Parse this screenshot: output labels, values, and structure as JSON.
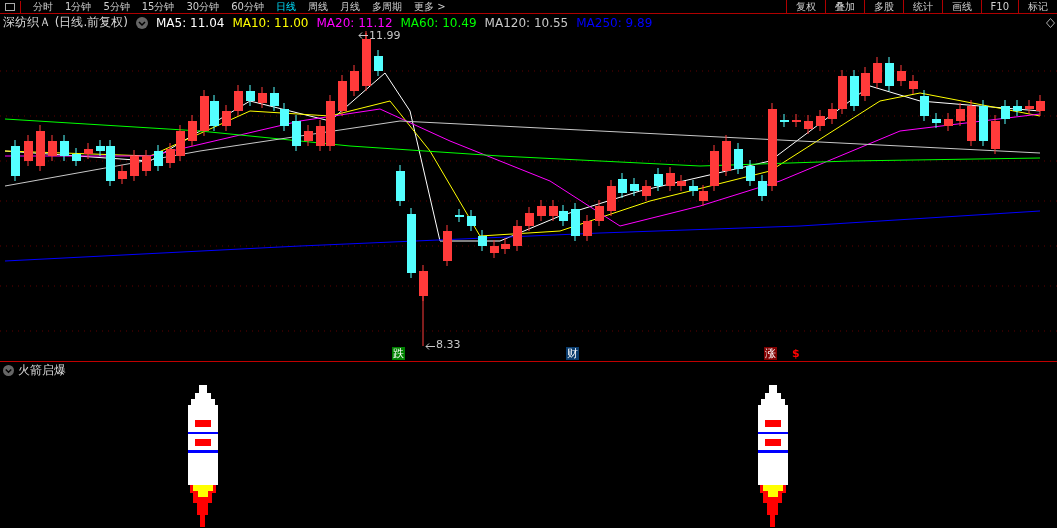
{
  "top_bar": {
    "periods": [
      {
        "label": "分时",
        "selected": false
      },
      {
        "label": "1分钟",
        "selected": false
      },
      {
        "label": "5分钟",
        "selected": false
      },
      {
        "label": "15分钟",
        "selected": false
      },
      {
        "label": "30分钟",
        "selected": false
      },
      {
        "label": "60分钟",
        "selected": false
      },
      {
        "label": "日线",
        "selected": true
      },
      {
        "label": "周线",
        "selected": false
      },
      {
        "label": "月线",
        "selected": false
      },
      {
        "label": "多周期",
        "selected": false
      },
      {
        "label": "更多 >",
        "selected": false
      }
    ],
    "tools": [
      "复权",
      "叠加",
      "多股",
      "统计",
      "画线",
      "F10",
      "标记"
    ]
  },
  "chart_header": {
    "title": "深纺织Ａ (日线.前复权)",
    "averages": [
      {
        "label": "MA5: 11.04",
        "color": "#ffffff"
      },
      {
        "label": "MA10: 11.00",
        "color": "#ffff00"
      },
      {
        "label": "MA20: 11.12",
        "color": "#ff00ff"
      },
      {
        "label": "MA60: 10.49",
        "color": "#00ff00"
      },
      {
        "label": "MA120: 10.55",
        "color": "#c8c8c8"
      },
      {
        "label": "MA250: 9.89",
        "color": "#0000ff"
      }
    ]
  },
  "chart": {
    "high_label": "11.99",
    "low_label": "8.33",
    "markers": [
      {
        "kind": "badge",
        "text": "跌",
        "color": "#008000"
      },
      {
        "kind": "badge",
        "text": "财",
        "color": "#0a3c6e"
      },
      {
        "kind": "badge",
        "text": "涨",
        "color": "#800000"
      },
      {
        "kind": "symbol",
        "text": "$",
        "color": "#ff0000"
      }
    ]
  },
  "indicator": {
    "title": "火箭启爆"
  }
}
